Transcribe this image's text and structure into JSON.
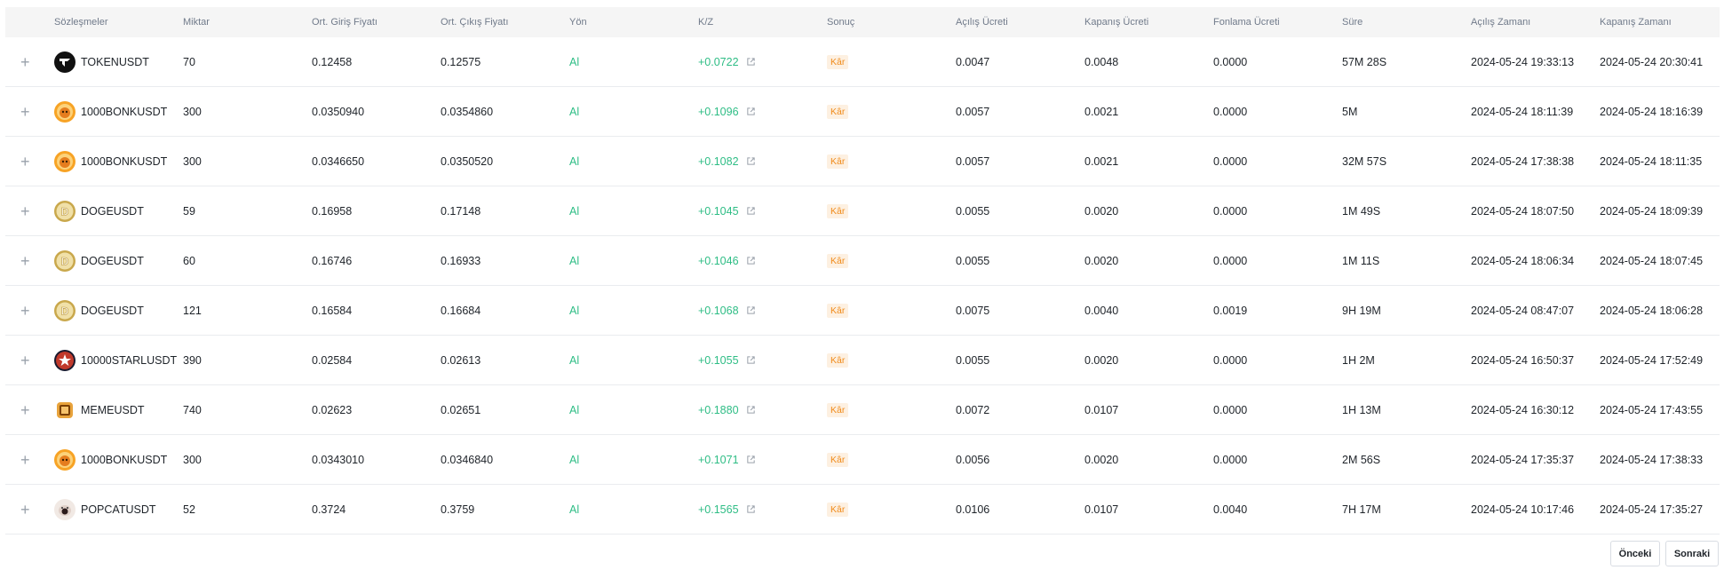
{
  "headers": [
    "",
    "Sözleşmeler",
    "Miktar",
    "Ort. Giriş Fiyatı",
    "Ort. Çıkış Fiyatı",
    "Yön",
    "K/Z",
    "Sonuç",
    "Açılış Ücreti",
    "Kapanış Ücreti",
    "Fonlama Ücreti",
    "Süre",
    "Açılış Zamanı",
    "Kapanış Zamanı"
  ],
  "rows": [
    {
      "expand": "+",
      "icon": "token-coin-icon",
      "symbol": "TOKENUSDT",
      "qty": "70",
      "entry": "0.12458",
      "exit": "0.12575",
      "side": "Al",
      "pnl": "+0.0722",
      "result": "Kâr",
      "open_fee": "0.0047",
      "close_fee": "0.0048",
      "funding_fee": "0.0000",
      "duration": "57M 28S",
      "open_time": "2024-05-24 19:33:13",
      "close_time": "2024-05-24 20:30:41"
    },
    {
      "expand": "+",
      "icon": "bonk-coin-icon",
      "symbol": "1000BONKUSDT",
      "qty": "300",
      "entry": "0.0350940",
      "exit": "0.0354860",
      "side": "Al",
      "pnl": "+0.1096",
      "result": "Kâr",
      "open_fee": "0.0057",
      "close_fee": "0.0021",
      "funding_fee": "0.0000",
      "duration": "5M",
      "open_time": "2024-05-24 18:11:39",
      "close_time": "2024-05-24 18:16:39"
    },
    {
      "expand": "+",
      "icon": "bonk-coin-icon",
      "symbol": "1000BONKUSDT",
      "qty": "300",
      "entry": "0.0346650",
      "exit": "0.0350520",
      "side": "Al",
      "pnl": "+0.1082",
      "result": "Kâr",
      "open_fee": "0.0057",
      "close_fee": "0.0021",
      "funding_fee": "0.0000",
      "duration": "32M 57S",
      "open_time": "2024-05-24 17:38:38",
      "close_time": "2024-05-24 18:11:35"
    },
    {
      "expand": "+",
      "icon": "doge-coin-icon",
      "symbol": "DOGEUSDT",
      "qty": "59",
      "entry": "0.16958",
      "exit": "0.17148",
      "side": "Al",
      "pnl": "+0.1045",
      "result": "Kâr",
      "open_fee": "0.0055",
      "close_fee": "0.0020",
      "funding_fee": "0.0000",
      "duration": "1M 49S",
      "open_time": "2024-05-24 18:07:50",
      "close_time": "2024-05-24 18:09:39"
    },
    {
      "expand": "+",
      "icon": "doge-coin-icon",
      "symbol": "DOGEUSDT",
      "qty": "60",
      "entry": "0.16746",
      "exit": "0.16933",
      "side": "Al",
      "pnl": "+0.1046",
      "result": "Kâr",
      "open_fee": "0.0055",
      "close_fee": "0.0020",
      "funding_fee": "0.0000",
      "duration": "1M 11S",
      "open_time": "2024-05-24 18:06:34",
      "close_time": "2024-05-24 18:07:45"
    },
    {
      "expand": "+",
      "icon": "doge-coin-icon",
      "symbol": "DOGEUSDT",
      "qty": "121",
      "entry": "0.16584",
      "exit": "0.16684",
      "side": "Al",
      "pnl": "+0.1068",
      "result": "Kâr",
      "open_fee": "0.0075",
      "close_fee": "0.0040",
      "funding_fee": "0.0019",
      "duration": "9H 19M",
      "open_time": "2024-05-24 08:47:07",
      "close_time": "2024-05-24 18:06:28"
    },
    {
      "expand": "+",
      "icon": "star-coin-icon",
      "symbol": "10000STARLUSDT",
      "qty": "390",
      "entry": "0.02584",
      "exit": "0.02613",
      "side": "Al",
      "pnl": "+0.1055",
      "result": "Kâr",
      "open_fee": "0.0055",
      "close_fee": "0.0020",
      "funding_fee": "0.0000",
      "duration": "1H 2M",
      "open_time": "2024-05-24 16:50:37",
      "close_time": "2024-05-24 17:52:49"
    },
    {
      "expand": "+",
      "icon": "meme-coin-icon",
      "symbol": "MEMEUSDT",
      "qty": "740",
      "entry": "0.02623",
      "exit": "0.02651",
      "side": "Al",
      "pnl": "+0.1880",
      "result": "Kâr",
      "open_fee": "0.0072",
      "close_fee": "0.0107",
      "funding_fee": "0.0000",
      "duration": "1H 13M",
      "open_time": "2024-05-24 16:30:12",
      "close_time": "2024-05-24 17:43:55"
    },
    {
      "expand": "+",
      "icon": "bonk-coin-icon",
      "symbol": "1000BONKUSDT",
      "qty": "300",
      "entry": "0.0343010",
      "exit": "0.0346840",
      "side": "Al",
      "pnl": "+0.1071",
      "result": "Kâr",
      "open_fee": "0.0056",
      "close_fee": "0.0020",
      "funding_fee": "0.0000",
      "duration": "2M 56S",
      "open_time": "2024-05-24 17:35:37",
      "close_time": "2024-05-24 17:38:33"
    },
    {
      "expand": "+",
      "icon": "popcat-coin-icon",
      "symbol": "POPCATUSDT",
      "qty": "52",
      "entry": "0.3724",
      "exit": "0.3759",
      "side": "Al",
      "pnl": "+0.1565",
      "result": "Kâr",
      "open_fee": "0.0106",
      "close_fee": "0.0107",
      "funding_fee": "0.0040",
      "duration": "7H 17M",
      "open_time": "2024-05-24 10:17:46",
      "close_time": "2024-05-24 17:35:27"
    }
  ],
  "pagination": {
    "prev": "Önceki",
    "next": "Sonraki"
  },
  "colors": {
    "buy": "#2ebd85",
    "profit_badge_bg": "#fdf0e1",
    "profit_badge_text": "#f08b1b",
    "header_bg": "#f5f5f5"
  }
}
